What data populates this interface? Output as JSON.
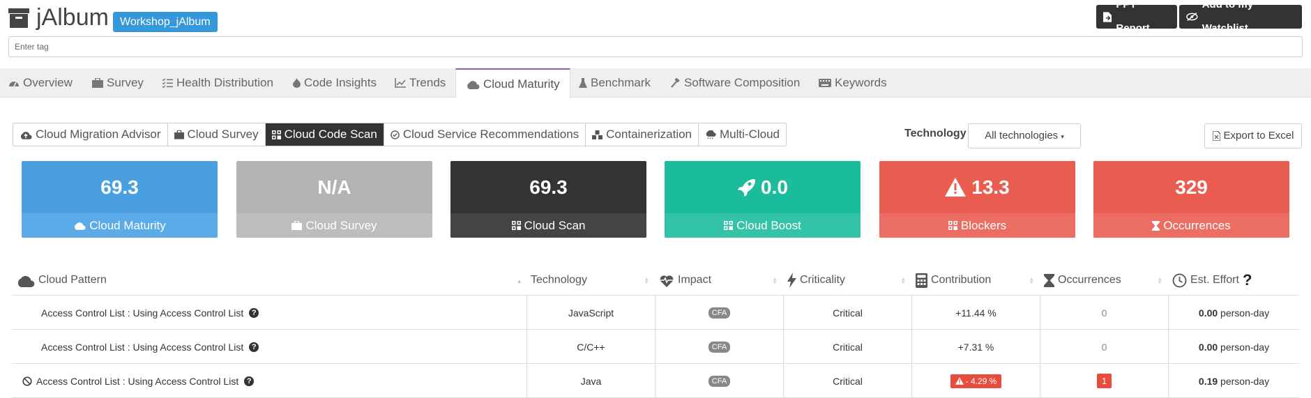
{
  "header": {
    "app_title": "jAlbum",
    "project": "Workshop_jAlbum",
    "ppt_report": "PPT Report",
    "watchlist": "Add to my Watchlist",
    "tag_placeholder": "Enter tag"
  },
  "tabs": [
    {
      "label": "Overview",
      "icon": "dashboard-icon"
    },
    {
      "label": "Survey",
      "icon": "briefcase-icon"
    },
    {
      "label": "Health Distribution",
      "icon": "list-check-icon"
    },
    {
      "label": "Code Insights",
      "icon": "fire-icon"
    },
    {
      "label": "Trends",
      "icon": "line-chart-icon"
    },
    {
      "label": "Cloud Maturity",
      "icon": "cloud-icon",
      "active": true
    },
    {
      "label": "Benchmark",
      "icon": "flask-icon"
    },
    {
      "label": "Software Composition",
      "icon": "hammer-icon"
    },
    {
      "label": "Keywords",
      "icon": "keyboard-icon"
    }
  ],
  "subtabs": [
    {
      "label": "Cloud Migration Advisor"
    },
    {
      "label": "Cloud Survey"
    },
    {
      "label": "Cloud Code Scan",
      "active": true
    },
    {
      "label": "Cloud Service Recommendations"
    },
    {
      "label": "Containerization"
    },
    {
      "label": "Multi-Cloud"
    }
  ],
  "toolbar": {
    "technology_label": "Technology :",
    "technology_value": "All technologies",
    "export": "Export to Excel"
  },
  "kpis": [
    {
      "value": "69.3",
      "label": "Cloud Maturity",
      "color": "#4a9fe0",
      "color2": "#5aabe8"
    },
    {
      "value": "N/A",
      "label": "Cloud Survey",
      "color": "#b3b3b3",
      "color2": "#bdbdbd"
    },
    {
      "value": "69.3",
      "label": "Cloud Scan",
      "color": "#333333",
      "color2": "#444444"
    },
    {
      "value": "0.0",
      "label": "Cloud Boost",
      "color": "#1abc9c",
      "color2": "#33c3a6"
    },
    {
      "value": "13.3",
      "label": "Blockers",
      "color": "#e95c4f",
      "color2": "#ec6d61"
    },
    {
      "value": "329",
      "label": "Occurrences",
      "color": "#e95c4f",
      "color2": "#ec6d61"
    }
  ],
  "table": {
    "columns": [
      "Cloud Pattern",
      "Technology",
      "Impact",
      "Criticality",
      "Contribution",
      "Occurrences",
      "Est. Effort"
    ],
    "rows": [
      {
        "pattern": "Access Control List : Using Access Control List",
        "technology": "JavaScript",
        "impact": "CFA",
        "criticality": "Critical",
        "contribution": "+11.44 %",
        "occurrences": "0",
        "effort_value": "0.00",
        "effort_unit": "person-day",
        "negative": false
      },
      {
        "pattern": "Access Control List : Using Access Control List",
        "technology": "C/C++",
        "impact": "CFA",
        "criticality": "Critical",
        "contribution": "+7.31 %",
        "occurrences": "0",
        "effort_value": "0.00",
        "effort_unit": "person-day",
        "negative": false
      },
      {
        "pattern": "Access Control List : Using Access Control List",
        "technology": "Java",
        "impact": "CFA",
        "criticality": "Critical",
        "contribution": "- 4.29 %",
        "occurrences": "1",
        "effort_value": "0.19",
        "effort_unit": "person-day",
        "negative": true
      }
    ]
  }
}
